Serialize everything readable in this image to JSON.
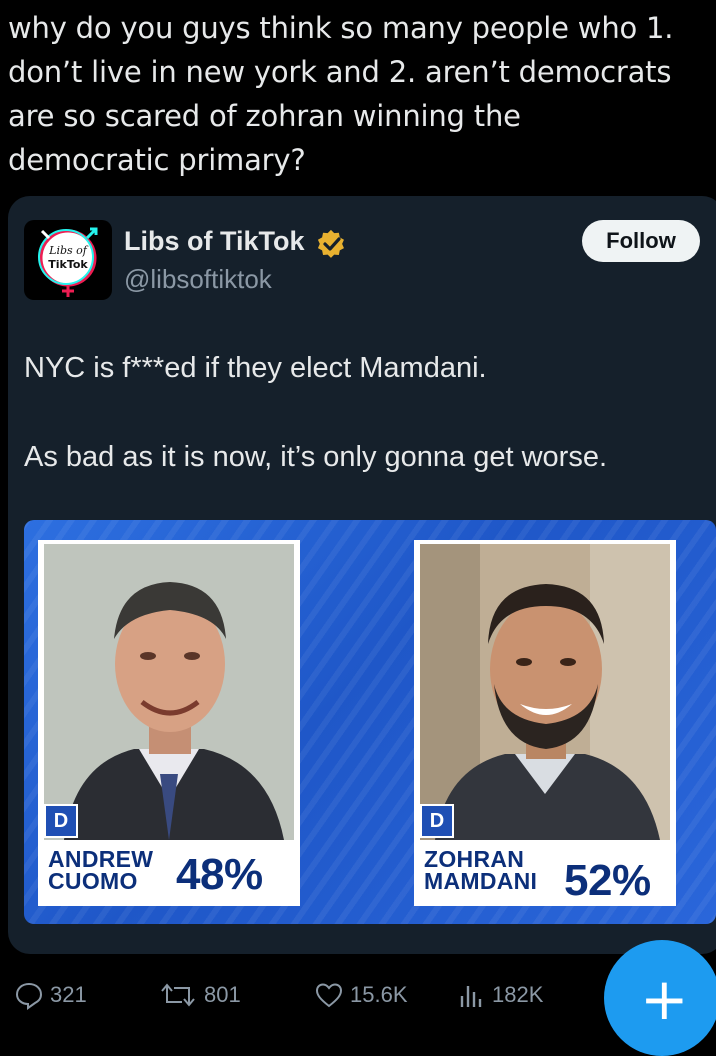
{
  "post": {
    "lines": [
      "why do you guys think so many people who 1.",
      "don’t live in new york and 2. aren’t democrats",
      "are so scared of zohran winning the",
      "democratic primary?"
    ]
  },
  "quoted": {
    "author_name": "Libs of TikTok",
    "author_handle": "@libsoftiktok",
    "avatar_text": [
      "Libs of",
      "TikTok"
    ],
    "follow_label": "Follow",
    "text_line1": "NYC is f***ed if they elect Mamdani.",
    "text_line2": "As bad as it is now, it’s only gonna get worse.",
    "media": {
      "candidates": [
        {
          "party": "D",
          "first": "ANDREW",
          "last": "CUOMO",
          "pct": "48%"
        },
        {
          "party": "D",
          "first": "ZOHRAN",
          "last": "MAMDANI",
          "pct": "52%"
        }
      ]
    }
  },
  "actions": {
    "replies": "321",
    "reposts": "801",
    "likes": "15.6K",
    "views": "182K"
  },
  "fab_label": "+",
  "colors": {
    "background": "#000000",
    "card": "#15202b",
    "accent": "#1d9bf0",
    "verified": "#e8b130",
    "muted": "#8b98a5"
  }
}
